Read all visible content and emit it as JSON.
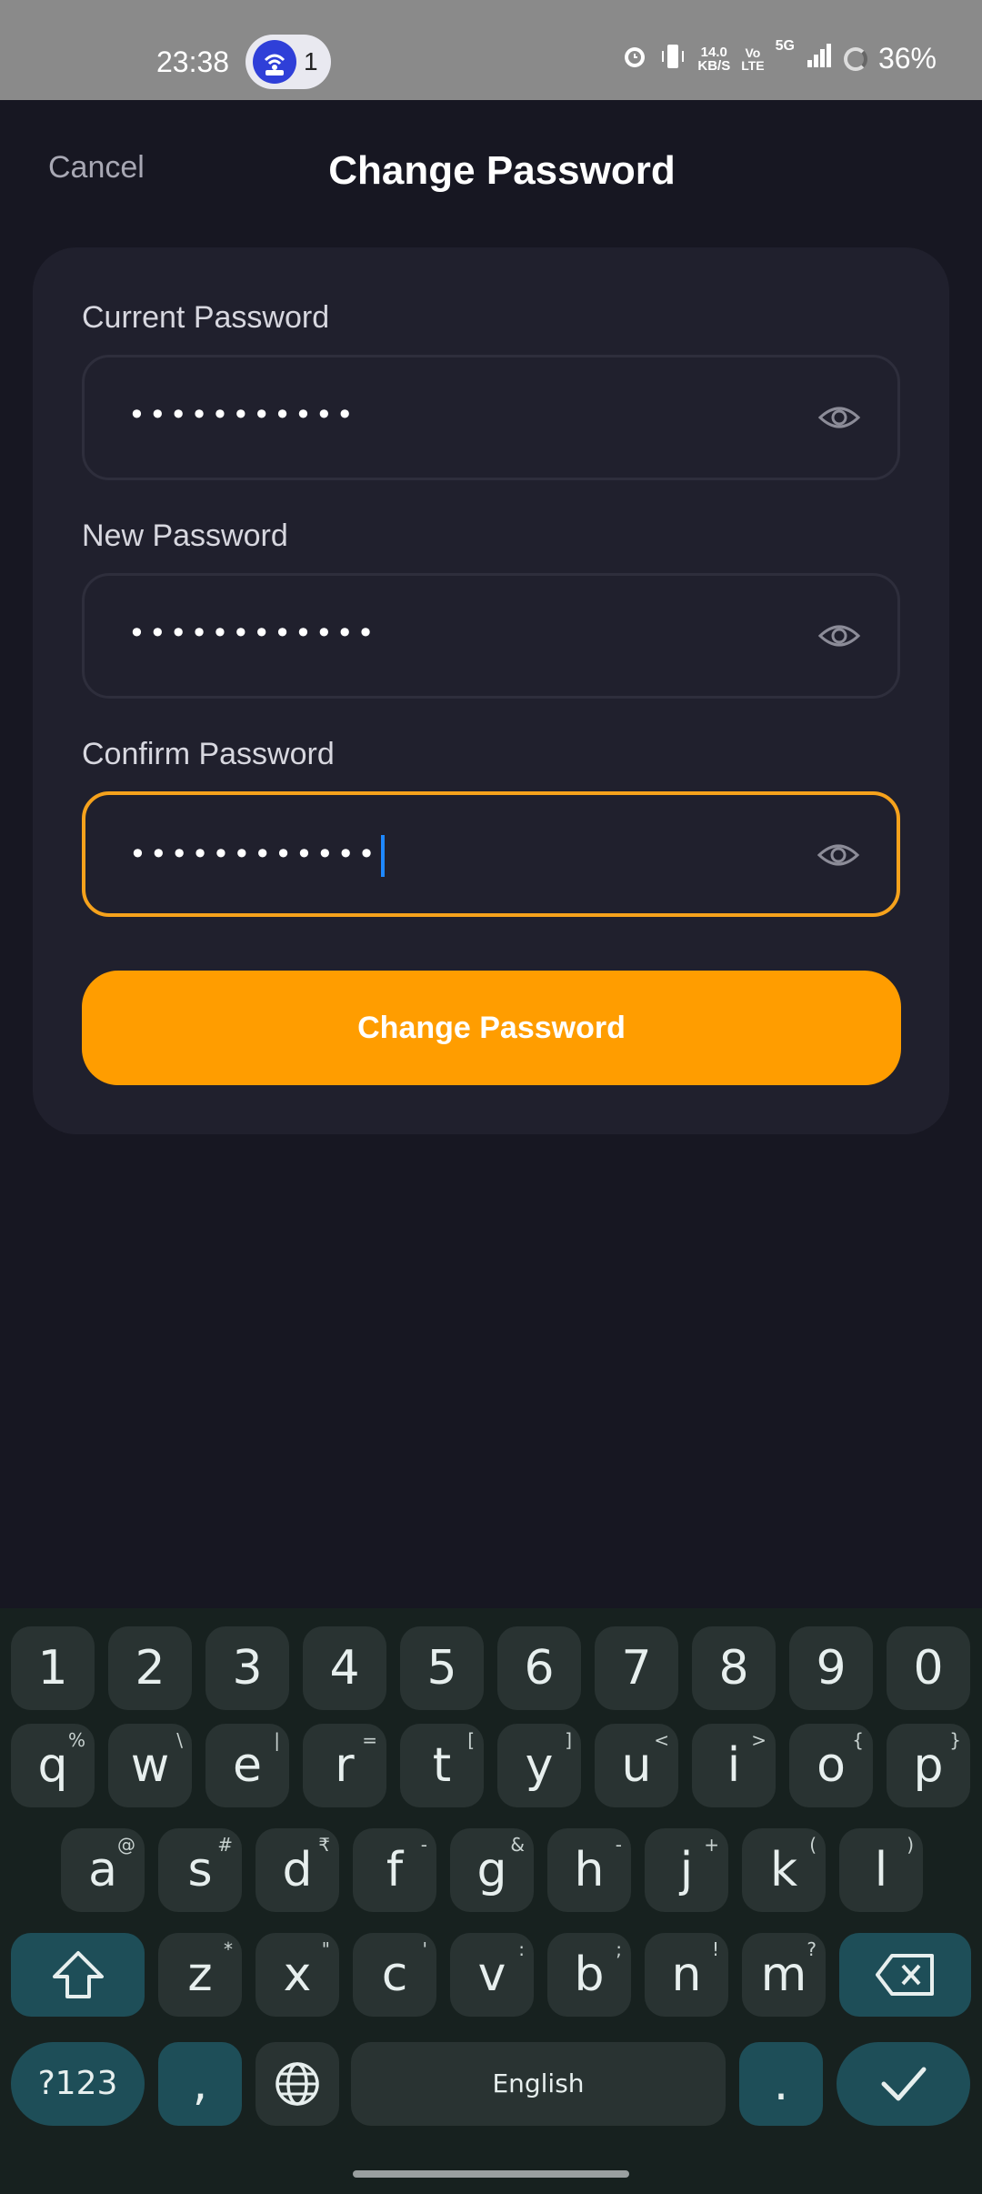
{
  "status_bar": {
    "time": "23:38",
    "notification_count": "1",
    "net_speed_value": "14.0",
    "net_speed_unit": "KB/S",
    "volte_top": "Vo",
    "volte_bottom": "LTE",
    "network": "5G",
    "battery": "36%",
    "icons": [
      "wifi-hotspot-icon",
      "alarm-icon",
      "vibrate-icon",
      "signal-icon",
      "battery-icon"
    ]
  },
  "header": {
    "cancel_label": "Cancel",
    "title": "Change Password"
  },
  "form": {
    "fields": [
      {
        "label": "Current Password",
        "value_masked": "•••••••••••",
        "focused": false
      },
      {
        "label": "New Password",
        "value_masked": "••••••••••••",
        "focused": false
      },
      {
        "label": "Confirm Password",
        "value_masked": "••••••••••••",
        "focused": true
      }
    ],
    "submit_label": "Change Password"
  },
  "keyboard": {
    "number_row": [
      "1",
      "2",
      "3",
      "4",
      "5",
      "6",
      "7",
      "8",
      "9",
      "0"
    ],
    "row1": [
      {
        "k": "q",
        "h": "%"
      },
      {
        "k": "w",
        "h": "\\"
      },
      {
        "k": "e",
        "h": "|"
      },
      {
        "k": "r",
        "h": "="
      },
      {
        "k": "t",
        "h": "["
      },
      {
        "k": "y",
        "h": "]"
      },
      {
        "k": "u",
        "h": "<"
      },
      {
        "k": "i",
        "h": ">"
      },
      {
        "k": "o",
        "h": "{"
      },
      {
        "k": "p",
        "h": "}"
      }
    ],
    "row2": [
      {
        "k": "a",
        "h": "@"
      },
      {
        "k": "s",
        "h": "#"
      },
      {
        "k": "d",
        "h": "₹"
      },
      {
        "k": "f",
        "h": "-"
      },
      {
        "k": "g",
        "h": "&"
      },
      {
        "k": "h",
        "h": "-"
      },
      {
        "k": "j",
        "h": "+"
      },
      {
        "k": "k",
        "h": "("
      },
      {
        "k": "l",
        "h": ")"
      }
    ],
    "row3": [
      {
        "k": "z",
        "h": "*"
      },
      {
        "k": "x",
        "h": "\""
      },
      {
        "k": "c",
        "h": "'"
      },
      {
        "k": "v",
        "h": ":"
      },
      {
        "k": "b",
        "h": ";"
      },
      {
        "k": "n",
        "h": "!"
      },
      {
        "k": "m",
        "h": "?"
      }
    ],
    "symbols_label": "?123",
    "comma_label": ",",
    "space_label": "English",
    "period_label": ".",
    "accent_color": "#ff9d00",
    "focus_color": "#f6a21c"
  }
}
